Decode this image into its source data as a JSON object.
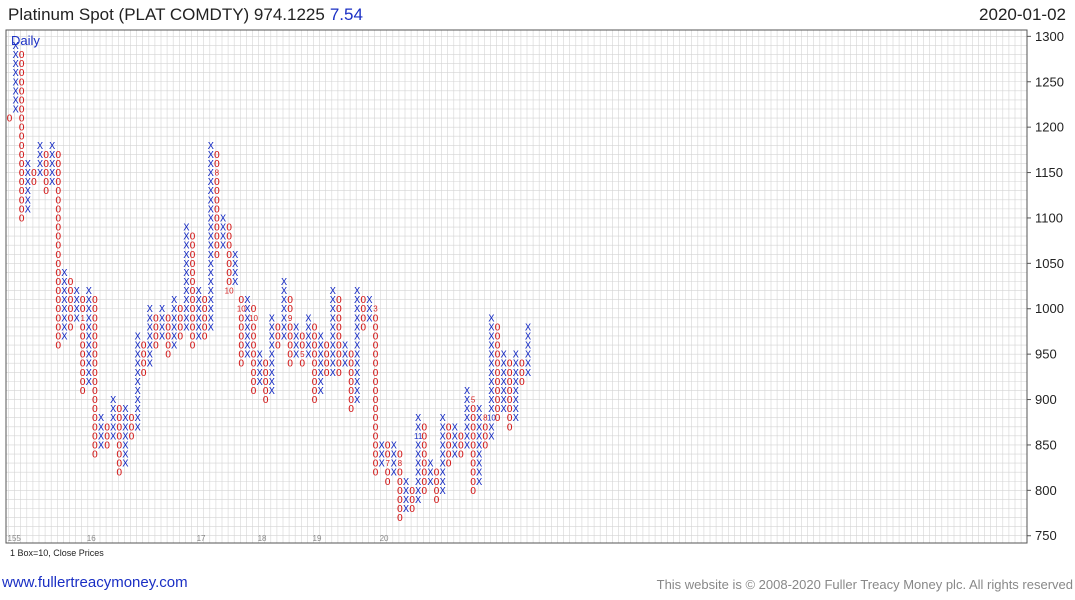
{
  "header": {
    "title": "Platinum Spot (PLAT COMDTY) 974.1225",
    "change": "7.54",
    "date": "2020-01-02"
  },
  "chart_data": {
    "type": "point-and-figure",
    "period_label": "Daily",
    "box_note": "1 Box=10, Close Prices",
    "box_size": 10,
    "ylim": [
      742,
      1307
    ],
    "y_ticks": [
      750,
      800,
      850,
      900,
      950,
      1000,
      1050,
      1100,
      1150,
      1200,
      1250,
      1300
    ],
    "grid": true,
    "x_labels": [
      {
        "text": "155",
        "col": 0
      },
      {
        "text": "16",
        "col": 13
      },
      {
        "text": "17",
        "col": 31
      },
      {
        "text": "18",
        "col": 41
      },
      {
        "text": "19",
        "col": 50
      },
      {
        "text": "20",
        "col": 61
      }
    ],
    "columns": [
      {
        "t": "O",
        "hi": 1210,
        "lo": 1210
      },
      {
        "t": "X",
        "hi": 1290,
        "lo": 1220
      },
      {
        "t": "O",
        "hi": 1280,
        "lo": 1100
      },
      {
        "t": "X",
        "hi": 1160,
        "lo": 1110
      },
      {
        "t": "O",
        "hi": 1150,
        "lo": 1140
      },
      {
        "t": "X",
        "hi": 1180,
        "lo": 1150
      },
      {
        "t": "O",
        "hi": 1170,
        "lo": 1130
      },
      {
        "t": "X",
        "hi": 1180,
        "lo": 1140
      },
      {
        "t": "O",
        "hi": 1170,
        "lo": 960
      },
      {
        "t": "X",
        "hi": 1040,
        "lo": 970
      },
      {
        "t": "O",
        "hi": 1030,
        "lo": 980
      },
      {
        "t": "X",
        "hi": 1020,
        "lo": 990
      },
      {
        "t": "O",
        "hi": 1010,
        "lo": 910
      },
      {
        "t": "X",
        "hi": 1020,
        "lo": 920
      },
      {
        "t": "O",
        "hi": 1010,
        "lo": 840
      },
      {
        "t": "X",
        "hi": 880,
        "lo": 850
      },
      {
        "t": "O",
        "hi": 870,
        "lo": 850
      },
      {
        "t": "X",
        "hi": 900,
        "lo": 860
      },
      {
        "t": "O",
        "hi": 890,
        "lo": 820
      },
      {
        "t": "X",
        "hi": 890,
        "lo": 830
      },
      {
        "t": "O",
        "hi": 880,
        "lo": 860
      },
      {
        "t": "X",
        "hi": 970,
        "lo": 870
      },
      {
        "t": "O",
        "hi": 960,
        "lo": 930
      },
      {
        "t": "X",
        "hi": 1000,
        "lo": 940
      },
      {
        "t": "O",
        "hi": 990,
        "lo": 960
      },
      {
        "t": "X",
        "hi": 1000,
        "lo": 970
      },
      {
        "t": "O",
        "hi": 990,
        "lo": 950
      },
      {
        "t": "X",
        "hi": 1010,
        "lo": 960
      },
      {
        "t": "O",
        "hi": 1000,
        "lo": 970
      },
      {
        "t": "X",
        "hi": 1090,
        "lo": 980
      },
      {
        "t": "O",
        "hi": 1080,
        "lo": 960
      },
      {
        "t": "X",
        "hi": 1020,
        "lo": 970
      },
      {
        "t": "O",
        "hi": 1010,
        "lo": 970
      },
      {
        "t": "X",
        "hi": 1180,
        "lo": 980
      },
      {
        "t": "O",
        "hi": 1170,
        "lo": 1060
      },
      {
        "t": "X",
        "hi": 1100,
        "lo": 1070
      },
      {
        "t": "O",
        "hi": 1090,
        "lo": 1020
      },
      {
        "t": "X",
        "hi": 1060,
        "lo": 1030
      },
      {
        "t": "O",
        "hi": 1010,
        "lo": 940
      },
      {
        "t": "X",
        "hi": 1010,
        "lo": 950
      },
      {
        "t": "O",
        "hi": 1000,
        "lo": 910
      },
      {
        "t": "X",
        "hi": 950,
        "lo": 920
      },
      {
        "t": "O",
        "hi": 940,
        "lo": 900
      },
      {
        "t": "X",
        "hi": 990,
        "lo": 910
      },
      {
        "t": "O",
        "hi": 980,
        "lo": 960
      },
      {
        "t": "X",
        "hi": 1030,
        "lo": 970
      },
      {
        "t": "O",
        "hi": 1010,
        "lo": 940
      },
      {
        "t": "X",
        "hi": 980,
        "lo": 950
      },
      {
        "t": "O",
        "hi": 970,
        "lo": 940
      },
      {
        "t": "X",
        "hi": 990,
        "lo": 950
      },
      {
        "t": "O",
        "hi": 980,
        "lo": 900
      },
      {
        "t": "X",
        "hi": 970,
        "lo": 910
      },
      {
        "t": "O",
        "hi": 960,
        "lo": 930
      },
      {
        "t": "X",
        "hi": 1020,
        "lo": 930
      },
      {
        "t": "O",
        "hi": 1010,
        "lo": 930
      },
      {
        "t": "X",
        "hi": 960,
        "lo": 940
      },
      {
        "t": "O",
        "hi": 950,
        "lo": 890
      },
      {
        "t": "X",
        "hi": 1020,
        "lo": 900
      },
      {
        "t": "O",
        "hi": 1010,
        "lo": 980
      },
      {
        "t": "X",
        "hi": 1010,
        "lo": 990
      },
      {
        "t": "O",
        "hi": 1000,
        "lo": 820
      },
      {
        "t": "X",
        "hi": 850,
        "lo": 830
      },
      {
        "t": "O",
        "hi": 850,
        "lo": 810
      },
      {
        "t": "X",
        "hi": 850,
        "lo": 820
      },
      {
        "t": "O",
        "hi": 840,
        "lo": 770
      },
      {
        "t": "X",
        "hi": 810,
        "lo": 780
      },
      {
        "t": "O",
        "hi": 800,
        "lo": 780
      },
      {
        "t": "X",
        "hi": 880,
        "lo": 790
      },
      {
        "t": "O",
        "hi": 870,
        "lo": 800
      },
      {
        "t": "X",
        "hi": 830,
        "lo": 810
      },
      {
        "t": "O",
        "hi": 820,
        "lo": 790
      },
      {
        "t": "X",
        "hi": 880,
        "lo": 800
      },
      {
        "t": "O",
        "hi": 870,
        "lo": 830
      },
      {
        "t": "X",
        "hi": 870,
        "lo": 840
      },
      {
        "t": "O",
        "hi": 860,
        "lo": 840
      },
      {
        "t": "X",
        "hi": 910,
        "lo": 850
      },
      {
        "t": "O",
        "hi": 900,
        "lo": 800
      },
      {
        "t": "X",
        "hi": 890,
        "lo": 810
      },
      {
        "t": "O",
        "hi": 880,
        "lo": 850
      },
      {
        "t": "X",
        "hi": 990,
        "lo": 860
      },
      {
        "t": "O",
        "hi": 980,
        "lo": 880
      },
      {
        "t": "X",
        "hi": 950,
        "lo": 890
      },
      {
        "t": "O",
        "hi": 940,
        "lo": 870
      },
      {
        "t": "X",
        "hi": 950,
        "lo": 880
      },
      {
        "t": "O",
        "hi": 940,
        "lo": 920
      },
      {
        "t": "X",
        "hi": 980,
        "lo": 930
      }
    ],
    "month_markers": [
      {
        "col": 6,
        "v": 1100,
        "text": "6"
      },
      {
        "col": 12,
        "v": 990,
        "text": "1"
      },
      {
        "col": 34,
        "v": 1150,
        "text": "8"
      },
      {
        "col": 34,
        "v": 1040,
        "text": "9"
      },
      {
        "col": 36,
        "v": 1020,
        "text": "10"
      },
      {
        "col": 38,
        "v": 1000,
        "text": "10"
      },
      {
        "col": 40,
        "v": 990,
        "text": "10"
      },
      {
        "col": 46,
        "v": 990,
        "text": "9"
      },
      {
        "col": 48,
        "v": 950,
        "text": "5"
      },
      {
        "col": 49,
        "v": 930,
        "text": "7"
      },
      {
        "col": 60,
        "v": 1000,
        "text": "3"
      },
      {
        "col": 61,
        "v": 890,
        "text": "5"
      },
      {
        "col": 62,
        "v": 830,
        "text": "7"
      },
      {
        "col": 64,
        "v": 830,
        "text": "8"
      },
      {
        "col": 67,
        "v": 860,
        "text": "11"
      },
      {
        "col": 76,
        "v": 900,
        "text": "5"
      },
      {
        "col": 78,
        "v": 880,
        "text": "8"
      },
      {
        "col": 79,
        "v": 880,
        "text": "10"
      }
    ]
  },
  "footer": {
    "site": "www.fullertreacymoney.com",
    "copyright": "This website is © 2008-2020 Fuller Treacy Money plc. All rights reserved"
  },
  "colors": {
    "x_mark": "#1a2fc4",
    "o_mark": "#d41c1c",
    "grid": "#d4d4d4",
    "axis": "#555555",
    "link": "#1a2fc4"
  }
}
